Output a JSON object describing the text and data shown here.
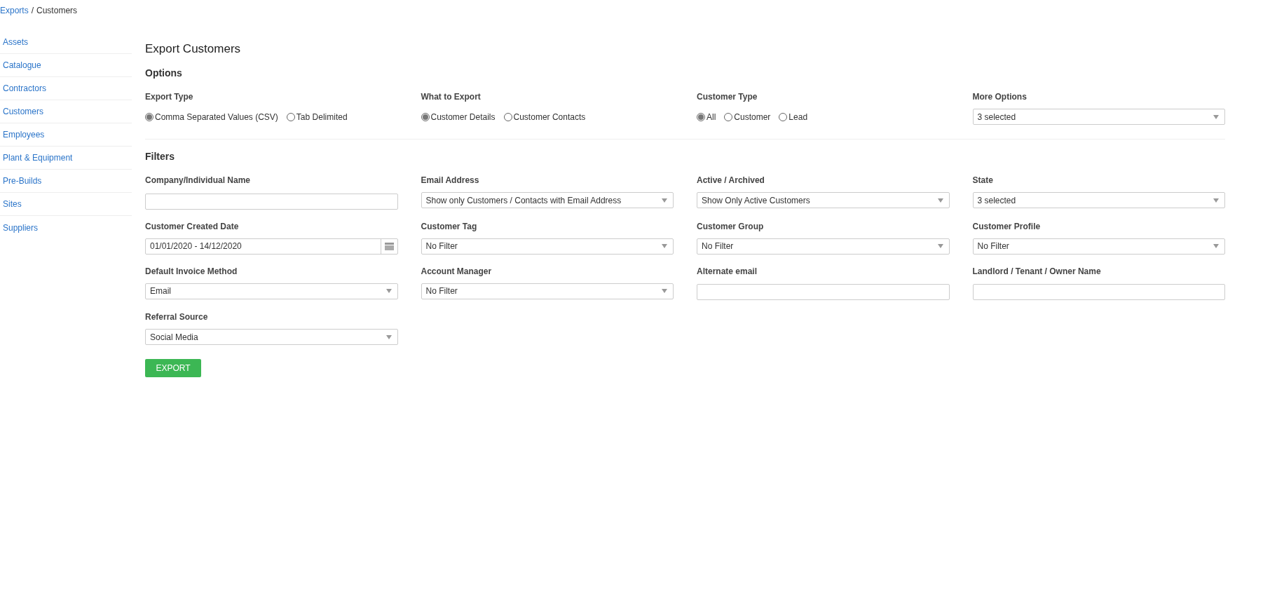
{
  "breadcrumb": {
    "link": "Exports",
    "separator": "/",
    "current": "Customers"
  },
  "sidebar": {
    "items": [
      {
        "label": "Assets"
      },
      {
        "label": "Catalogue"
      },
      {
        "label": "Contractors"
      },
      {
        "label": "Customers"
      },
      {
        "label": "Employees"
      },
      {
        "label": "Plant & Equipment"
      },
      {
        "label": "Pre-Builds"
      },
      {
        "label": "Sites"
      },
      {
        "label": "Suppliers"
      }
    ]
  },
  "title": "Export Customers",
  "options": {
    "heading": "Options",
    "groups": [
      {
        "kind": "radio",
        "label": "Export Type",
        "choices": [
          {
            "label": "Comma Separated Values (CSV)",
            "selected": true
          },
          {
            "label": "Tab Delimited",
            "selected": false
          }
        ]
      },
      {
        "kind": "radio",
        "label": "What to Export",
        "choices": [
          {
            "label": "Customer Details",
            "selected": true
          },
          {
            "label": "Customer Contacts",
            "selected": false
          }
        ]
      },
      {
        "kind": "radio",
        "label": "Customer Type",
        "choices": [
          {
            "label": "All",
            "selected": true
          },
          {
            "label": "Customer",
            "selected": false
          },
          {
            "label": "Lead",
            "selected": false
          }
        ]
      },
      {
        "kind": "select",
        "label": "More Options",
        "value": "3 selected"
      }
    ]
  },
  "filters": {
    "heading": "Filters",
    "fields": [
      {
        "kind": "text",
        "label": "Company/Individual Name"
      },
      {
        "kind": "select",
        "label": "Email Address",
        "value": "Show only Customers / Contacts with Email Address"
      },
      {
        "kind": "select",
        "label": "Active / Archived",
        "value": "Show Only Active Customers"
      },
      {
        "kind": "select",
        "label": "State",
        "value": "3 selected"
      },
      {
        "kind": "date",
        "label": "Customer Created Date",
        "value": "01/01/2020 - 14/12/2020"
      },
      {
        "kind": "select",
        "label": "Customer Tag",
        "value": "No Filter"
      },
      {
        "kind": "select",
        "label": "Customer Group",
        "value": "No Filter"
      },
      {
        "kind": "select",
        "label": "Customer Profile",
        "value": "No Filter"
      },
      {
        "kind": "select",
        "label": "Default Invoice Method",
        "value": "Email"
      },
      {
        "kind": "select",
        "label": "Account Manager",
        "value": "No Filter"
      },
      {
        "kind": "text",
        "label": "Alternate email"
      },
      {
        "kind": "text",
        "label": "Landlord / Tenant / Owner Name"
      },
      {
        "kind": "select",
        "label": "Referral Source",
        "value": "Social Media"
      }
    ]
  },
  "export_button": "EXPORT"
}
